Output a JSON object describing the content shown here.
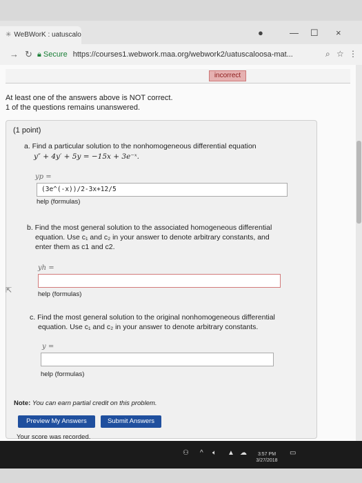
{
  "browser": {
    "tab_title": "WeBWorK : uatuscaloos",
    "security_label": "Secure",
    "url": "https://courses1.webwork.maa.org/webwork2/uatuscaloosa-mat...",
    "close_glyph": "×",
    "minimize_glyph": "—",
    "maximize_glyph": "☐"
  },
  "status": {
    "badge": "incorrect",
    "line1": "At least one of the answers above is NOT correct.",
    "line2": "1 of the questions remains unanswered."
  },
  "problem": {
    "points": "(1 point)",
    "part_a": {
      "prompt": "a. Find a particular solution to the nonhomogeneous differential equation",
      "equation": "y″ + 4y′ + 5y = −15x + 3e⁻ˣ.",
      "answer_label": "yp =",
      "answer_value": "(3e^(-x))/2-3x+12/5",
      "help": "help (formulas)"
    },
    "part_b": {
      "prompt_line1": "b. Find the most general solution to the associated homogeneous differential",
      "prompt_line2": "equation. Use c₁ and c₂ in your answer to denote arbitrary constants, and",
      "prompt_line3": "enter them as c1 and c2.",
      "answer_label": "yh =",
      "answer_value": "",
      "help": "help (formulas)"
    },
    "part_c": {
      "prompt_line1": "c. Find the most general solution to the original nonhomogeneous differential",
      "prompt_line2": "equation. Use c₁ and c₂ in your answer to denote arbitrary constants.",
      "answer_label": "y =",
      "answer_value": "",
      "help": "help (formulas)"
    }
  },
  "note": {
    "label": "Note:",
    "text": "You can earn partial credit on this problem."
  },
  "buttons": {
    "preview": "Preview My Answers",
    "submit": "Submit Answers"
  },
  "recorded": "Your score was recorded.",
  "taskbar": {
    "time": "3:57 PM",
    "date": "3/27/2018"
  },
  "colors": {
    "button_blue": "#1f4f9e",
    "incorrect_red": "#d27a7a"
  }
}
